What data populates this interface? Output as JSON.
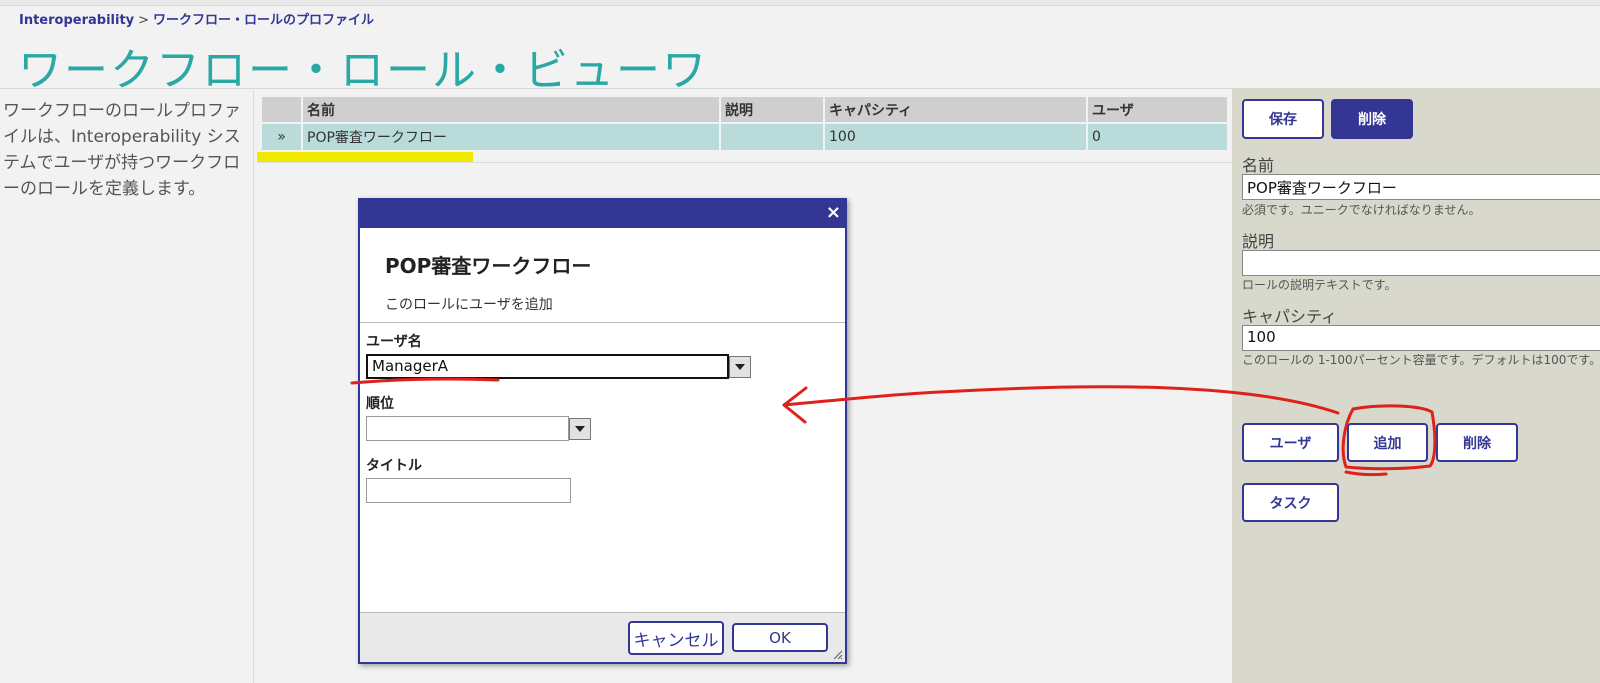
{
  "breadcrumb": {
    "root": "Interoperability",
    "separator": ">",
    "current": "ワークフロー・ロールのプロファイル"
  },
  "page": {
    "title": "ワークフロー・ロール・ビューワ"
  },
  "description": "ワークフローのロールプロファイルは、Interoperability システムでユーザが持つワークフローのロールを定義します。",
  "table": {
    "headers": {
      "name": "名前",
      "desc": "説明",
      "capacity": "キャパシティ",
      "users": "ユーザ"
    },
    "rows": [
      {
        "selector": "»",
        "name": "POP審査ワークフロー",
        "desc": "",
        "capacity": "100",
        "users": "0"
      }
    ]
  },
  "dialog": {
    "close_glyph": "×",
    "heading": "POP審査ワークフロー",
    "subheading": "このロールにユーザを追加",
    "username_label": "ユーザ名",
    "username_value": "ManagerA",
    "rank_label": "順位",
    "rank_value": "",
    "title_label": "タイトル",
    "title_value": "",
    "cancel_label": "キャンセル",
    "ok_label": "OK"
  },
  "panel": {
    "save_label": "保存",
    "delete_label": "削除",
    "name_label": "名前",
    "name_value": "POP審査ワークフロー",
    "name_help": "必須です。ユニークでなければなりません。",
    "desc_label": "説明",
    "desc_value": "",
    "desc_help": "ロールの説明テキストです。",
    "capacity_label": "キャパシティ",
    "capacity_value": "100",
    "capacity_help": "このロールの 1-100パーセント容量です。デフォルトは100です。",
    "users_button": "ユーザ",
    "add_button": "追加",
    "remove_button": "削除",
    "tasks_button": "タスク"
  },
  "colors": {
    "brand": "#333695",
    "title": "#2aa8a4",
    "row_selected": "#b9dbd9",
    "highlight": "#f0ea00",
    "annotation": "#e0201b",
    "panel_bg": "#d8d8cc"
  }
}
